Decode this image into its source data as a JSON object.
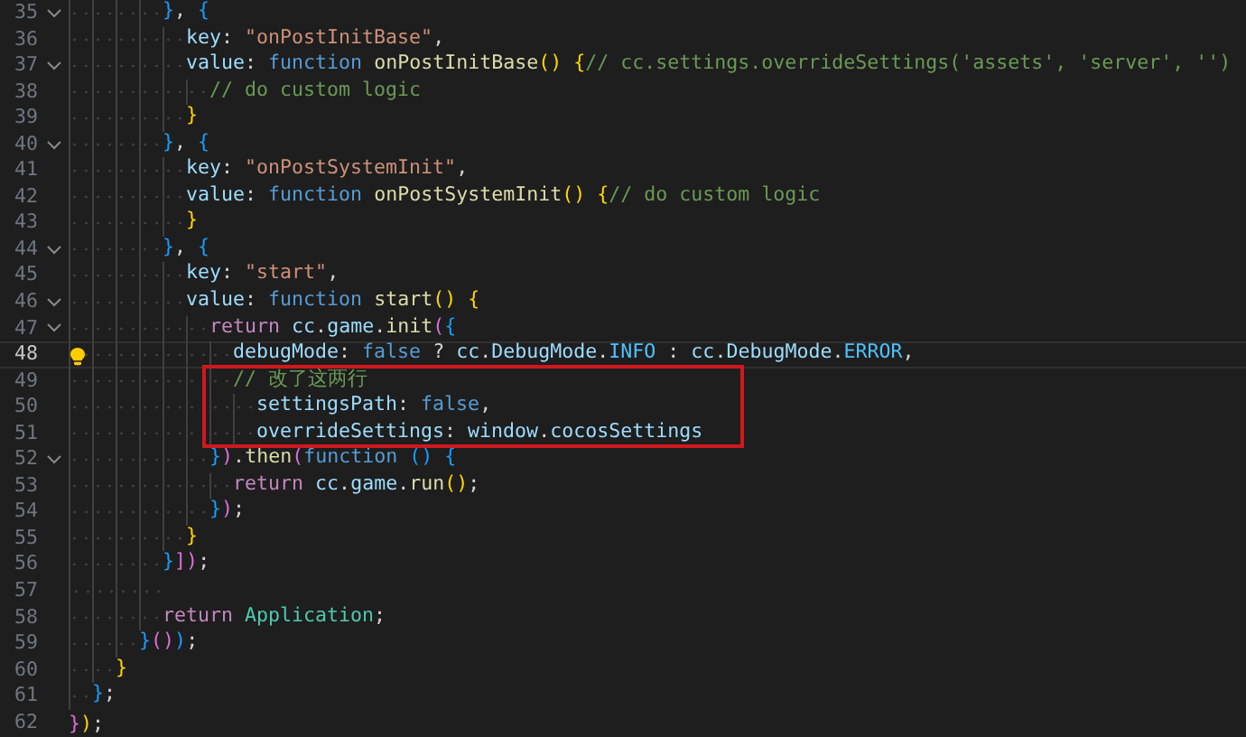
{
  "editor": {
    "lines": [
      {
        "number": "35",
        "fold": true,
        "active": false,
        "hint": false,
        "tokens": [
          {
            "kind": "b3",
            "text": "        }"
          },
          {
            "kind": "p",
            "text": ", "
          },
          {
            "kind": "b3",
            "text": "{"
          }
        ]
      },
      {
        "number": "36",
        "fold": false,
        "active": false,
        "hint": false,
        "tokens": [
          {
            "kind": "v",
            "text": "          key"
          },
          {
            "kind": "p",
            "text": ": "
          },
          {
            "kind": "s",
            "text": "\"onPostInitBase\""
          },
          {
            "kind": "p",
            "text": ","
          }
        ]
      },
      {
        "number": "37",
        "fold": true,
        "active": false,
        "hint": false,
        "tokens": [
          {
            "kind": "v",
            "text": "          value"
          },
          {
            "kind": "p",
            "text": ": "
          },
          {
            "kind": "k",
            "text": "function "
          },
          {
            "kind": "f",
            "text": "onPostInitBase"
          },
          {
            "kind": "b1",
            "text": "() {"
          },
          {
            "kind": "c",
            "text": "// cc.settings.overrideSettings('assets', 'server', '')"
          }
        ]
      },
      {
        "number": "38",
        "fold": false,
        "active": false,
        "hint": false,
        "tokens": [
          {
            "kind": "c",
            "text": "            // do custom logic"
          }
        ]
      },
      {
        "number": "39",
        "fold": false,
        "active": false,
        "hint": false,
        "tokens": [
          {
            "kind": "b1",
            "text": "          }"
          }
        ]
      },
      {
        "number": "40",
        "fold": true,
        "active": false,
        "hint": false,
        "tokens": [
          {
            "kind": "b3",
            "text": "        }"
          },
          {
            "kind": "p",
            "text": ", "
          },
          {
            "kind": "b3",
            "text": "{"
          }
        ]
      },
      {
        "number": "41",
        "fold": false,
        "active": false,
        "hint": false,
        "tokens": [
          {
            "kind": "v",
            "text": "          key"
          },
          {
            "kind": "p",
            "text": ": "
          },
          {
            "kind": "s",
            "text": "\"onPostSystemInit\""
          },
          {
            "kind": "p",
            "text": ","
          }
        ]
      },
      {
        "number": "42",
        "fold": false,
        "active": false,
        "hint": false,
        "tokens": [
          {
            "kind": "v",
            "text": "          value"
          },
          {
            "kind": "p",
            "text": ": "
          },
          {
            "kind": "k",
            "text": "function "
          },
          {
            "kind": "f",
            "text": "onPostSystemInit"
          },
          {
            "kind": "b1",
            "text": "() {"
          },
          {
            "kind": "c",
            "text": "// do custom logic"
          }
        ]
      },
      {
        "number": "43",
        "fold": false,
        "active": false,
        "hint": false,
        "tokens": [
          {
            "kind": "b1",
            "text": "          }"
          }
        ]
      },
      {
        "number": "44",
        "fold": true,
        "active": false,
        "hint": false,
        "tokens": [
          {
            "kind": "b3",
            "text": "        }"
          },
          {
            "kind": "p",
            "text": ", "
          },
          {
            "kind": "b3",
            "text": "{"
          }
        ]
      },
      {
        "number": "45",
        "fold": false,
        "active": false,
        "hint": false,
        "tokens": [
          {
            "kind": "v",
            "text": "          key"
          },
          {
            "kind": "p",
            "text": ": "
          },
          {
            "kind": "s",
            "text": "\"start\""
          },
          {
            "kind": "p",
            "text": ","
          }
        ]
      },
      {
        "number": "46",
        "fold": true,
        "active": false,
        "hint": false,
        "tokens": [
          {
            "kind": "v",
            "text": "          value"
          },
          {
            "kind": "p",
            "text": ": "
          },
          {
            "kind": "k",
            "text": "function "
          },
          {
            "kind": "f",
            "text": "start"
          },
          {
            "kind": "b1",
            "text": "() {"
          }
        ]
      },
      {
        "number": "47",
        "fold": true,
        "active": false,
        "hint": false,
        "tokens": [
          {
            "kind": "r",
            "text": "            return "
          },
          {
            "kind": "v",
            "text": "cc"
          },
          {
            "kind": "p",
            "text": "."
          },
          {
            "kind": "v",
            "text": "game"
          },
          {
            "kind": "p",
            "text": "."
          },
          {
            "kind": "f",
            "text": "init"
          },
          {
            "kind": "b2",
            "text": "("
          },
          {
            "kind": "b3",
            "text": "{"
          }
        ]
      },
      {
        "number": "48",
        "fold": false,
        "active": true,
        "hint": true,
        "tokens": [
          {
            "kind": "v",
            "text": "              debugMode"
          },
          {
            "kind": "p",
            "text": ": "
          },
          {
            "kind": "k",
            "text": "false"
          },
          {
            "kind": "p",
            "text": " ? "
          },
          {
            "kind": "v",
            "text": "cc"
          },
          {
            "kind": "p",
            "text": "."
          },
          {
            "kind": "v",
            "text": "DebugMode"
          },
          {
            "kind": "p",
            "text": "."
          },
          {
            "kind": "n",
            "text": "INFO"
          },
          {
            "kind": "p",
            "text": " : "
          },
          {
            "kind": "v",
            "text": "cc"
          },
          {
            "kind": "p",
            "text": "."
          },
          {
            "kind": "v",
            "text": "DebugMode"
          },
          {
            "kind": "p",
            "text": "."
          },
          {
            "kind": "n",
            "text": "ERROR"
          },
          {
            "kind": "p",
            "text": ","
          }
        ]
      },
      {
        "number": "49",
        "fold": false,
        "active": false,
        "hint": false,
        "tokens": [
          {
            "kind": "c",
            "text": "              // 改了这两行"
          }
        ]
      },
      {
        "number": "50",
        "fold": false,
        "active": false,
        "hint": false,
        "tokens": [
          {
            "kind": "v",
            "text": "                settingsPath"
          },
          {
            "kind": "p",
            "text": ": "
          },
          {
            "kind": "k",
            "text": "false"
          },
          {
            "kind": "p",
            "text": ","
          }
        ]
      },
      {
        "number": "51",
        "fold": false,
        "active": false,
        "hint": false,
        "tokens": [
          {
            "kind": "v",
            "text": "                overrideSettings"
          },
          {
            "kind": "p",
            "text": ": "
          },
          {
            "kind": "v",
            "text": "window"
          },
          {
            "kind": "p",
            "text": "."
          },
          {
            "kind": "v",
            "text": "cocosSettings"
          }
        ]
      },
      {
        "number": "52",
        "fold": true,
        "active": false,
        "hint": false,
        "tokens": [
          {
            "kind": "b3",
            "text": "            }"
          },
          {
            "kind": "b2",
            "text": ")"
          },
          {
            "kind": "p",
            "text": "."
          },
          {
            "kind": "f",
            "text": "then"
          },
          {
            "kind": "b2",
            "text": "("
          },
          {
            "kind": "k",
            "text": "function "
          },
          {
            "kind": "b3",
            "text": "() {"
          }
        ]
      },
      {
        "number": "53",
        "fold": false,
        "active": false,
        "hint": false,
        "tokens": [
          {
            "kind": "r",
            "text": "              return "
          },
          {
            "kind": "v",
            "text": "cc"
          },
          {
            "kind": "p",
            "text": "."
          },
          {
            "kind": "v",
            "text": "game"
          },
          {
            "kind": "p",
            "text": "."
          },
          {
            "kind": "f",
            "text": "run"
          },
          {
            "kind": "b1",
            "text": "()"
          },
          {
            "kind": "p",
            "text": ";"
          }
        ]
      },
      {
        "number": "54",
        "fold": false,
        "active": false,
        "hint": false,
        "tokens": [
          {
            "kind": "b3",
            "text": "            }"
          },
          {
            "kind": "b2",
            "text": ")"
          },
          {
            "kind": "p",
            "text": ";"
          }
        ]
      },
      {
        "number": "55",
        "fold": false,
        "active": false,
        "hint": false,
        "tokens": [
          {
            "kind": "b1",
            "text": "          }"
          }
        ]
      },
      {
        "number": "56",
        "fold": false,
        "active": false,
        "hint": false,
        "tokens": [
          {
            "kind": "b3",
            "text": "        }"
          },
          {
            "kind": "b2",
            "text": "]"
          },
          {
            "kind": "b2",
            "text": ")"
          },
          {
            "kind": "p",
            "text": ";"
          }
        ]
      },
      {
        "number": "57",
        "fold": false,
        "active": false,
        "hint": false
      },
      {
        "number": "58",
        "fold": false,
        "active": false,
        "hint": false,
        "tokens": [
          {
            "kind": "r",
            "text": "        return "
          },
          {
            "kind": "t",
            "text": "Application"
          },
          {
            "kind": "p",
            "text": ";"
          }
        ]
      },
      {
        "number": "59",
        "fold": false,
        "active": false,
        "hint": false,
        "tokens": [
          {
            "kind": "b3",
            "text": "      }"
          },
          {
            "kind": "b2",
            "text": "()"
          },
          {
            "kind": "b3",
            "text": ")"
          },
          {
            "kind": "p",
            "text": ";"
          }
        ]
      },
      {
        "number": "60",
        "fold": false,
        "active": false,
        "hint": false,
        "tokens": [
          {
            "kind": "b1",
            "text": "    }"
          }
        ]
      },
      {
        "number": "61",
        "fold": false,
        "active": false,
        "hint": false,
        "tokens": [
          {
            "kind": "b3",
            "text": "  }"
          },
          {
            "kind": "p",
            "text": ";"
          }
        ]
      },
      {
        "number": "62",
        "fold": false,
        "active": false,
        "hint": false,
        "tokens": [
          {
            "kind": "b2",
            "text": "}"
          },
          {
            "kind": "b1",
            "text": ")"
          },
          {
            "kind": "p",
            "text": ";"
          }
        ]
      }
    ]
  }
}
